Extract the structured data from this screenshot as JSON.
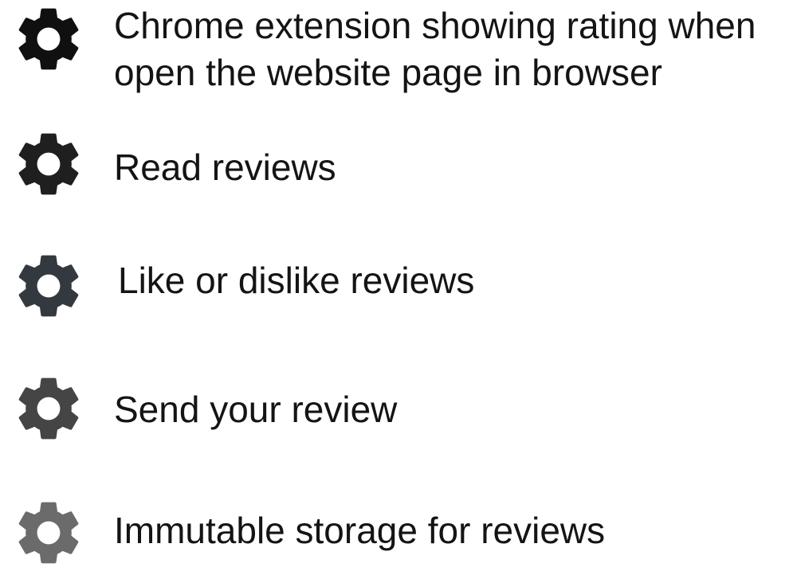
{
  "features": [
    {
      "icon": "gear-icon",
      "color": "#101010",
      "lines": [
        "Chrome extension showing rating when",
        "open the website page in browser"
      ]
    },
    {
      "icon": "gear-icon",
      "color": "#1f1f1f",
      "lines": [
        "Read reviews"
      ]
    },
    {
      "icon": "gear-icon",
      "color": "#33393f",
      "lines": [
        "Like or dislike reviews"
      ]
    },
    {
      "icon": "gear-icon",
      "color": "#454545",
      "lines": [
        "Send your review"
      ]
    },
    {
      "icon": "gear-icon",
      "color": "#6b6b6b",
      "lines": [
        "Immutable storage for reviews"
      ]
    }
  ]
}
